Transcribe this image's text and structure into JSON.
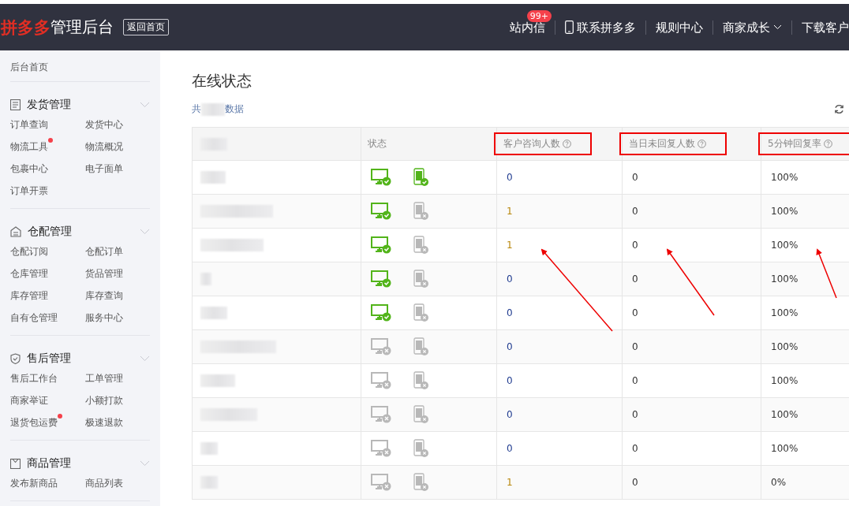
{
  "topbar": {
    "logo_brand": "拼多多",
    "logo_title": "管理后台",
    "home_button": "返回首页",
    "nav": [
      {
        "kind": "badge",
        "label": "站内信",
        "badge": "99+"
      },
      {
        "kind": "phone",
        "label": "联系拼多多"
      },
      {
        "kind": "plain",
        "label": "规则中心"
      },
      {
        "kind": "dropdown",
        "label": "商家成长"
      },
      {
        "kind": "plain",
        "label": "下载客户"
      }
    ]
  },
  "sidebar": {
    "home": "后台首页",
    "sections": [
      {
        "kind": "doc",
        "title": "发货管理",
        "items": [
          {
            "label": "订单查询",
            "dot": false
          },
          {
            "label": "发货中心",
            "dot": false
          },
          {
            "label": "物流工具",
            "dot": true
          },
          {
            "label": "物流概况",
            "dot": false
          },
          {
            "label": "包裹中心",
            "dot": false
          },
          {
            "label": "电子面单",
            "dot": false
          },
          {
            "label": "订单开票",
            "dot": false
          }
        ]
      },
      {
        "kind": "house",
        "title": "仓配管理",
        "items": [
          {
            "label": "仓配订阅",
            "dot": false
          },
          {
            "label": "仓配订单",
            "dot": false
          },
          {
            "label": "仓库管理",
            "dot": false
          },
          {
            "label": "货品管理",
            "dot": false
          },
          {
            "label": "库存管理",
            "dot": false
          },
          {
            "label": "库存查询",
            "dot": false
          },
          {
            "label": "自有仓管理",
            "dot": false
          },
          {
            "label": "服务中心",
            "dot": false
          }
        ]
      },
      {
        "kind": "shield",
        "title": "售后管理",
        "items": [
          {
            "label": "售后工作台",
            "dot": false
          },
          {
            "label": "工单管理",
            "dot": false
          },
          {
            "label": "商家举证",
            "dot": false
          },
          {
            "label": "小额打款",
            "dot": false
          },
          {
            "label": "退货包运费",
            "dot": true
          },
          {
            "label": "极速退款",
            "dot": false
          }
        ]
      },
      {
        "kind": "bag",
        "title": "商品管理",
        "items": [
          {
            "label": "发布新商品",
            "dot": false
          },
          {
            "label": "商品列表",
            "dot": false
          }
        ]
      }
    ]
  },
  "page": {
    "title": "在线状态",
    "total_prefix": "共",
    "total_suffix": "数据"
  },
  "table": {
    "columns": [
      {
        "kind": "blurred",
        "highlighted": false
      },
      {
        "kind": "status",
        "label": "状态",
        "highlighted": false
      },
      {
        "kind": "help",
        "label": "客户咨询人数",
        "highlighted": true
      },
      {
        "kind": "help",
        "label": "当日未回复人数",
        "highlighted": true
      },
      {
        "kind": "help",
        "label": "5分钟回复率",
        "highlighted": true
      }
    ],
    "rows": [
      {
        "desktop_online": true,
        "mobile_online": true,
        "consults": {
          "value": "0",
          "color": "#1f3b8f"
        },
        "unreplied": "0",
        "reply_rate": "100%"
      },
      {
        "desktop_online": true,
        "mobile_online": false,
        "consults": {
          "value": "1",
          "color": "#b8860b"
        },
        "unreplied": "0",
        "reply_rate": "100%"
      },
      {
        "desktop_online": true,
        "mobile_online": false,
        "consults": {
          "value": "1",
          "color": "#b8860b"
        },
        "unreplied": "0",
        "reply_rate": "100%"
      },
      {
        "desktop_online": true,
        "mobile_online": false,
        "consults": {
          "value": "0",
          "color": "#1f3b8f"
        },
        "unreplied": "0",
        "reply_rate": "100%"
      },
      {
        "desktop_online": true,
        "mobile_online": false,
        "consults": {
          "value": "0",
          "color": "#1f3b8f"
        },
        "unreplied": "0",
        "reply_rate": "100%"
      },
      {
        "desktop_online": false,
        "mobile_online": false,
        "consults": {
          "value": "0",
          "color": "#1f3b8f"
        },
        "unreplied": "0",
        "reply_rate": "100%"
      },
      {
        "desktop_online": false,
        "mobile_online": false,
        "consults": {
          "value": "0",
          "color": "#1f3b8f"
        },
        "unreplied": "0",
        "reply_rate": "100%"
      },
      {
        "desktop_online": false,
        "mobile_online": false,
        "consults": {
          "value": "0",
          "color": "#1f3b8f"
        },
        "unreplied": "0",
        "reply_rate": "100%"
      },
      {
        "desktop_online": false,
        "mobile_online": false,
        "consults": {
          "value": "0",
          "color": "#1f3b8f"
        },
        "unreplied": "0",
        "reply_rate": "100%"
      },
      {
        "desktop_online": false,
        "mobile_online": false,
        "consults": {
          "value": "1",
          "color": "#b8860b"
        },
        "unreplied": "0",
        "reply_rate": "0%"
      }
    ]
  }
}
